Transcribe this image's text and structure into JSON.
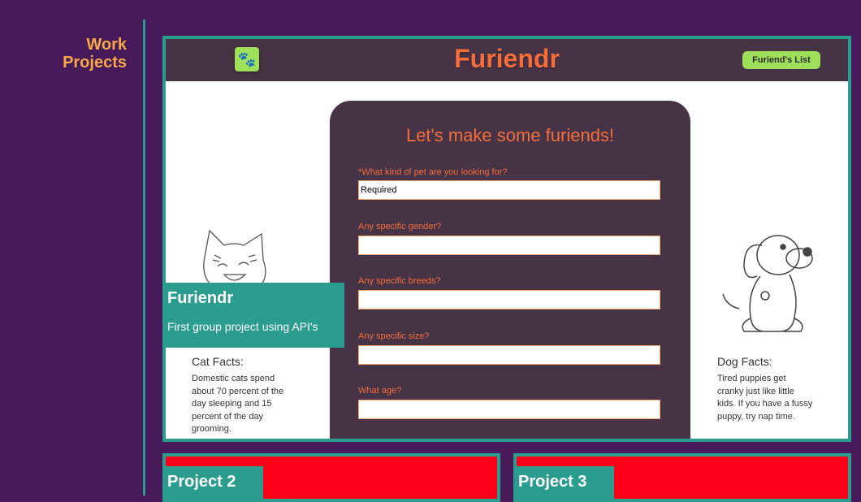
{
  "sidebar": {
    "title_line1": "Work",
    "title_line2": "Projects"
  },
  "projects": [
    {
      "title": "Furiendr",
      "description": "First group project using API's",
      "screenshot": {
        "brand": "Furiendr",
        "nav_button": "Furiend's List",
        "logo_icon": "paw-icon",
        "heading": "Let's make some furiends!",
        "fields": [
          {
            "label": "*What kind of pet are you looking for?",
            "value": "Required"
          },
          {
            "label": "Any specific gender?",
            "value": ""
          },
          {
            "label": "Any specific breeds?",
            "value": ""
          },
          {
            "label": "Any specific size?",
            "value": ""
          },
          {
            "label": "What age?",
            "value": ""
          }
        ],
        "cat_facts": {
          "title": "Cat Facts:",
          "lines": [
            "Domestic cats spend",
            "about 70 percent of the",
            "day sleeping and 15",
            "percent of the day",
            "grooming."
          ]
        },
        "dog_facts": {
          "title": "Dog Facts:",
          "lines": [
            "Tired puppies get",
            "cranky just like little",
            "kids. If you have a fussy",
            "puppy, try nap time."
          ]
        }
      }
    },
    {
      "title": "Project 2"
    },
    {
      "title": "Project 3"
    }
  ],
  "colors": {
    "background": "#471b59",
    "accent": "#2a9d8f",
    "heading": "#f8a848",
    "brand": "#f46d3a",
    "placeholder_card": "#ff0018"
  }
}
